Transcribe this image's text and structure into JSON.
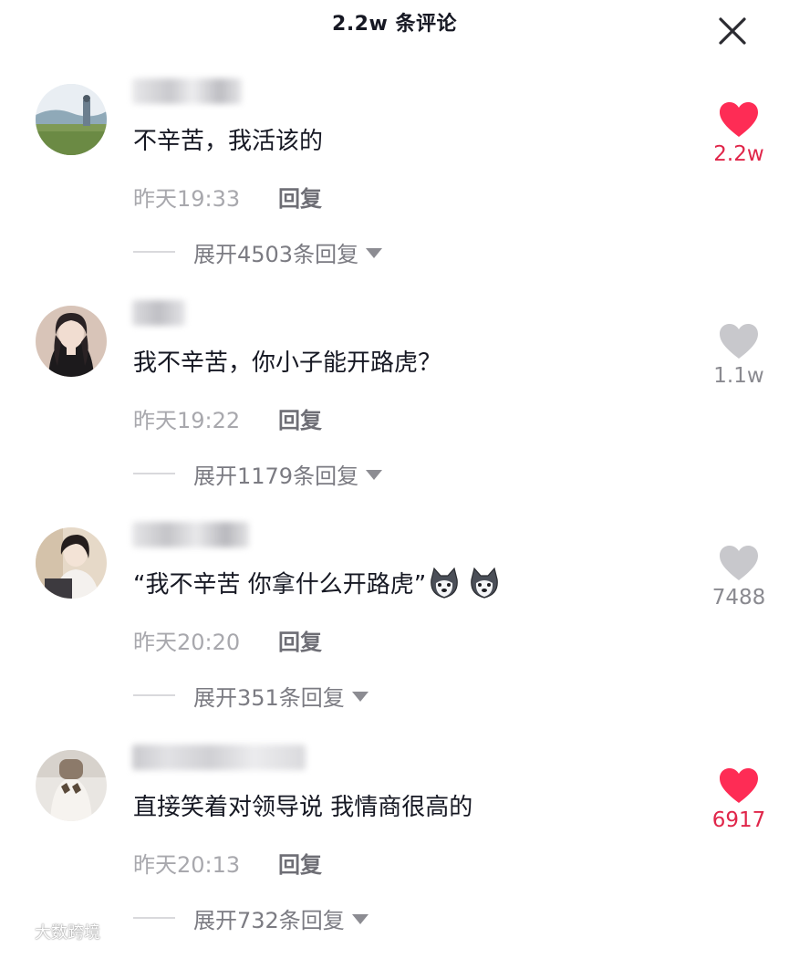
{
  "header": {
    "title": "2.2w 条评论",
    "close_icon": "close-icon"
  },
  "comments": [
    {
      "text": "不辛苦，我活该的",
      "time": "昨天19:33",
      "reply_label": "回复",
      "expand_label": "展开4503条回复",
      "like_count": "2.2w",
      "liked": true,
      "emoji": []
    },
    {
      "text": "我不辛苦，你小子能开路虎？",
      "time": "昨天19:22",
      "reply_label": "回复",
      "expand_label": "展开1179条回复",
      "like_count": "1.1w",
      "liked": false,
      "emoji": []
    },
    {
      "text": "“我不辛苦 你拿什么开路虎”",
      "time": "昨天20:20",
      "reply_label": "回复",
      "expand_label": "展开351条回复",
      "like_count": "7488",
      "liked": false,
      "emoji": [
        "husky-emoji",
        "husky-emoji"
      ]
    },
    {
      "text": "直接笑着对领导说 我情商很高的",
      "time": "昨天20:13",
      "reply_label": "回复",
      "expand_label": "展开732条回复",
      "like_count": "6917",
      "liked": true,
      "emoji": []
    }
  ],
  "watermark": {
    "text": "大数跨境"
  },
  "colors": {
    "liked": "#fe2c55",
    "unliked": "#c8c8cc",
    "liked_count": "#e0264a",
    "unliked_count": "#8a8a90"
  }
}
